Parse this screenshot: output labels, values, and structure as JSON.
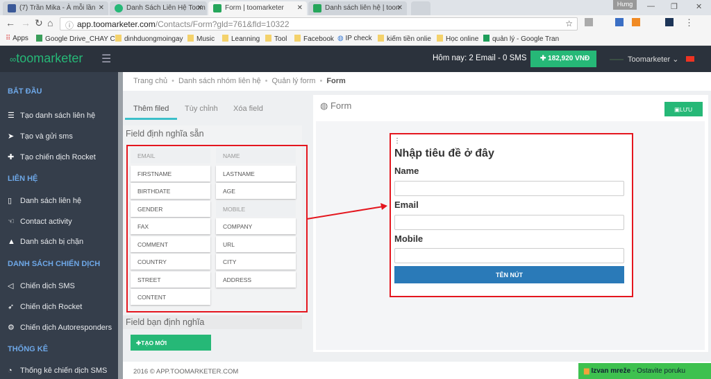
{
  "browser": {
    "tabs": [
      {
        "title": "(7) Trần Mika - À mỗi lần",
        "color": "#3b5998"
      },
      {
        "title": "Danh Sách Liên Hệ Toom",
        "color": "#26b877"
      },
      {
        "title": "Form | toomarketer",
        "color": "#26a65b",
        "active": true
      },
      {
        "title": "Danh sách liên hệ | toon",
        "color": "#26a65b"
      }
    ],
    "profile": "Hưng",
    "url_host": "app.toomarketer.com",
    "url_path": "/Contacts/Form?gld=761&fld=10322",
    "bookmarks": [
      "Apps",
      "Google Drive_CHAY C",
      "dinhduongmoingay",
      "Music",
      "Leanning",
      "Tool",
      "Facebook",
      "IP check",
      "kiếm tiền onlie",
      "Học online",
      "quản lý - Google Tran"
    ]
  },
  "header": {
    "logo": "toomarketer",
    "today": "Hôm nay: 2 Email - 0 SMS",
    "balance": "182,920 VNĐ",
    "user": "Toomarketer"
  },
  "sidebar": {
    "sections": [
      {
        "title": "BẮT ĐẦU",
        "items": [
          {
            "label": "Tạo danh sách liên hệ",
            "icon": "list-icon"
          },
          {
            "label": "Tạo và gửi sms",
            "icon": "send-icon"
          },
          {
            "label": "Tạo chiến dịch Rocket",
            "icon": "plus-icon"
          }
        ]
      },
      {
        "title": "LIÊN HỆ",
        "items": [
          {
            "label": "Danh sách liên hệ",
            "icon": "book-icon"
          },
          {
            "label": "Contact activity",
            "icon": "hand-icon"
          },
          {
            "label": "Danh sách bị chặn",
            "icon": "warning-icon"
          }
        ]
      },
      {
        "title": "DANH SÁCH CHIẾN DỊCH",
        "items": [
          {
            "label": "Chiến dịch SMS",
            "icon": "paper-plane-icon"
          },
          {
            "label": "Chiến dịch Rocket",
            "icon": "rocket-icon"
          },
          {
            "label": "Chiến dịch Autoresponders",
            "icon": "cogs-icon"
          }
        ]
      },
      {
        "title": "THỐNG KÊ",
        "items": [
          {
            "label": "Thống kê chiến dịch SMS",
            "icon": "pie-chart-icon"
          }
        ]
      }
    ]
  },
  "breadcrumb": [
    "Trang chủ",
    "Danh sách nhóm liên hệ",
    "Quản lý form",
    "Form"
  ],
  "left": {
    "tabs": [
      "Thêm filed",
      "Tùy chỉnh",
      "Xóa field"
    ],
    "predefined_title": "Field định nghĩa sẵn",
    "fields": [
      {
        "label": "EMAIL",
        "used": true
      },
      {
        "label": "NAME",
        "used": true
      },
      {
        "label": "FIRSTNAME"
      },
      {
        "label": "LASTNAME"
      },
      {
        "label": "BIRTHDATE"
      },
      {
        "label": "AGE"
      },
      {
        "label": "GENDER"
      },
      {
        "label": "MOBILE",
        "used": true
      },
      {
        "label": "FAX"
      },
      {
        "label": "COMPANY"
      },
      {
        "label": "COMMENT"
      },
      {
        "label": "URL"
      },
      {
        "label": "COUNTRY"
      },
      {
        "label": "CITY"
      },
      {
        "label": "STREET"
      },
      {
        "label": "ADDRESS"
      },
      {
        "label": "CONTENT"
      }
    ],
    "custom_title": "Field bạn định nghĩa",
    "create_label": "TẠO MỚI"
  },
  "form": {
    "panel_title": "Form",
    "save_label": "LƯU",
    "heading": "Nhập tiêu đề ở đây",
    "fields": [
      "Name",
      "Email",
      "Mobile"
    ],
    "submit_label": "TÊN NÚT"
  },
  "footer": {
    "copyright": "2016 © APP.TOOMARKETER.COM",
    "chat_status": "Izvan mreže",
    "chat_action": "Ostavite poruku"
  },
  "colors": {
    "accent": "#26b877",
    "sidebar": "#353e4b",
    "header": "#2b323c",
    "submit": "#2a7ab8",
    "highlight": "#e4161e"
  }
}
